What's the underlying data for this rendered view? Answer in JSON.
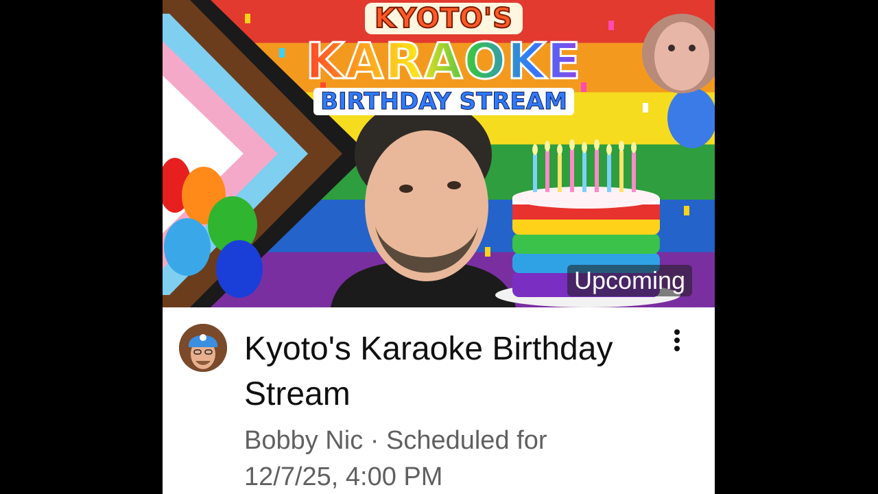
{
  "video": {
    "thumbnail": {
      "title_line1": "KYOTO'S",
      "title_line2": "KARAOKE",
      "title_line3": "BIRTHDAY STREAM",
      "status_badge": "Upcoming"
    },
    "title": "Kyoto's Karaoke Birthday Stream",
    "channel": "Bobby Nic",
    "separator": " · ",
    "schedule_prefix": "Scheduled for",
    "schedule_time": "12/7/25, 4:00 PM"
  },
  "icons": {
    "more": "more-vert-icon",
    "avatar": "channel-avatar"
  },
  "colors": {
    "background": "#000000",
    "card": "#ffffff",
    "title_text": "#0f0f0f",
    "meta_text": "#606060"
  }
}
